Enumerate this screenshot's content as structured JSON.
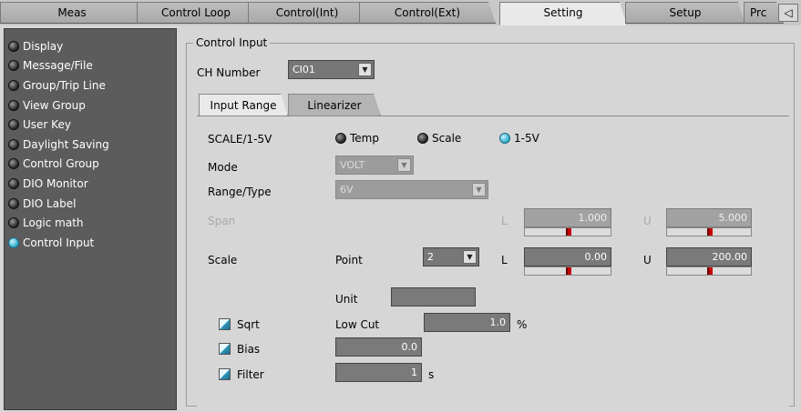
{
  "tabs": [
    {
      "label": "Meas"
    },
    {
      "label": "Control Loop"
    },
    {
      "label": "Control(Int)"
    },
    {
      "label": "Control(Ext)"
    },
    {
      "label": "Setting"
    },
    {
      "label": "Setup"
    },
    {
      "label": "Prc"
    }
  ],
  "tab_scroll_label": "◁",
  "sidebar": {
    "items": [
      {
        "label": "Display"
      },
      {
        "label": "Message/File"
      },
      {
        "label": "Group/Trip Line"
      },
      {
        "label": "View Group"
      },
      {
        "label": "User Key"
      },
      {
        "label": "Daylight Saving"
      },
      {
        "label": "Control Group"
      },
      {
        "label": "DIO Monitor"
      },
      {
        "label": "DIO Label"
      },
      {
        "label": "Logic math"
      },
      {
        "label": "Control Input"
      }
    ]
  },
  "main": {
    "group_title": "Control Input",
    "ch_label": "CH Number",
    "ch_value": "CI01",
    "subtabs": [
      "Input Range",
      "Linearizer"
    ],
    "scale_label": "SCALE/1-5V",
    "radios": [
      "Temp",
      "Scale",
      "1-5V"
    ],
    "mode_label": "Mode",
    "mode_value": "VOLT",
    "range_label": "Range/Type",
    "range_value": "6V",
    "span_label": "Span",
    "span_l_label": "L",
    "span_l_value": "1.000",
    "span_u_label": "U",
    "span_u_value": "5.000",
    "scale_row_label": "Scale",
    "point_label": "Point",
    "point_value": "2",
    "scale_l_label": "L",
    "scale_l_value": "0.00",
    "scale_u_label": "U",
    "scale_u_value": "200.00",
    "unit_label": "Unit",
    "unit_value": "",
    "sqrt_label": "Sqrt",
    "lowcut_label": "Low Cut",
    "lowcut_value": "1.0",
    "lowcut_unit": "%",
    "bias_label": "Bias",
    "bias_value": "0.0",
    "filter_label": "Filter",
    "filter_value": "1",
    "filter_unit": "s"
  }
}
